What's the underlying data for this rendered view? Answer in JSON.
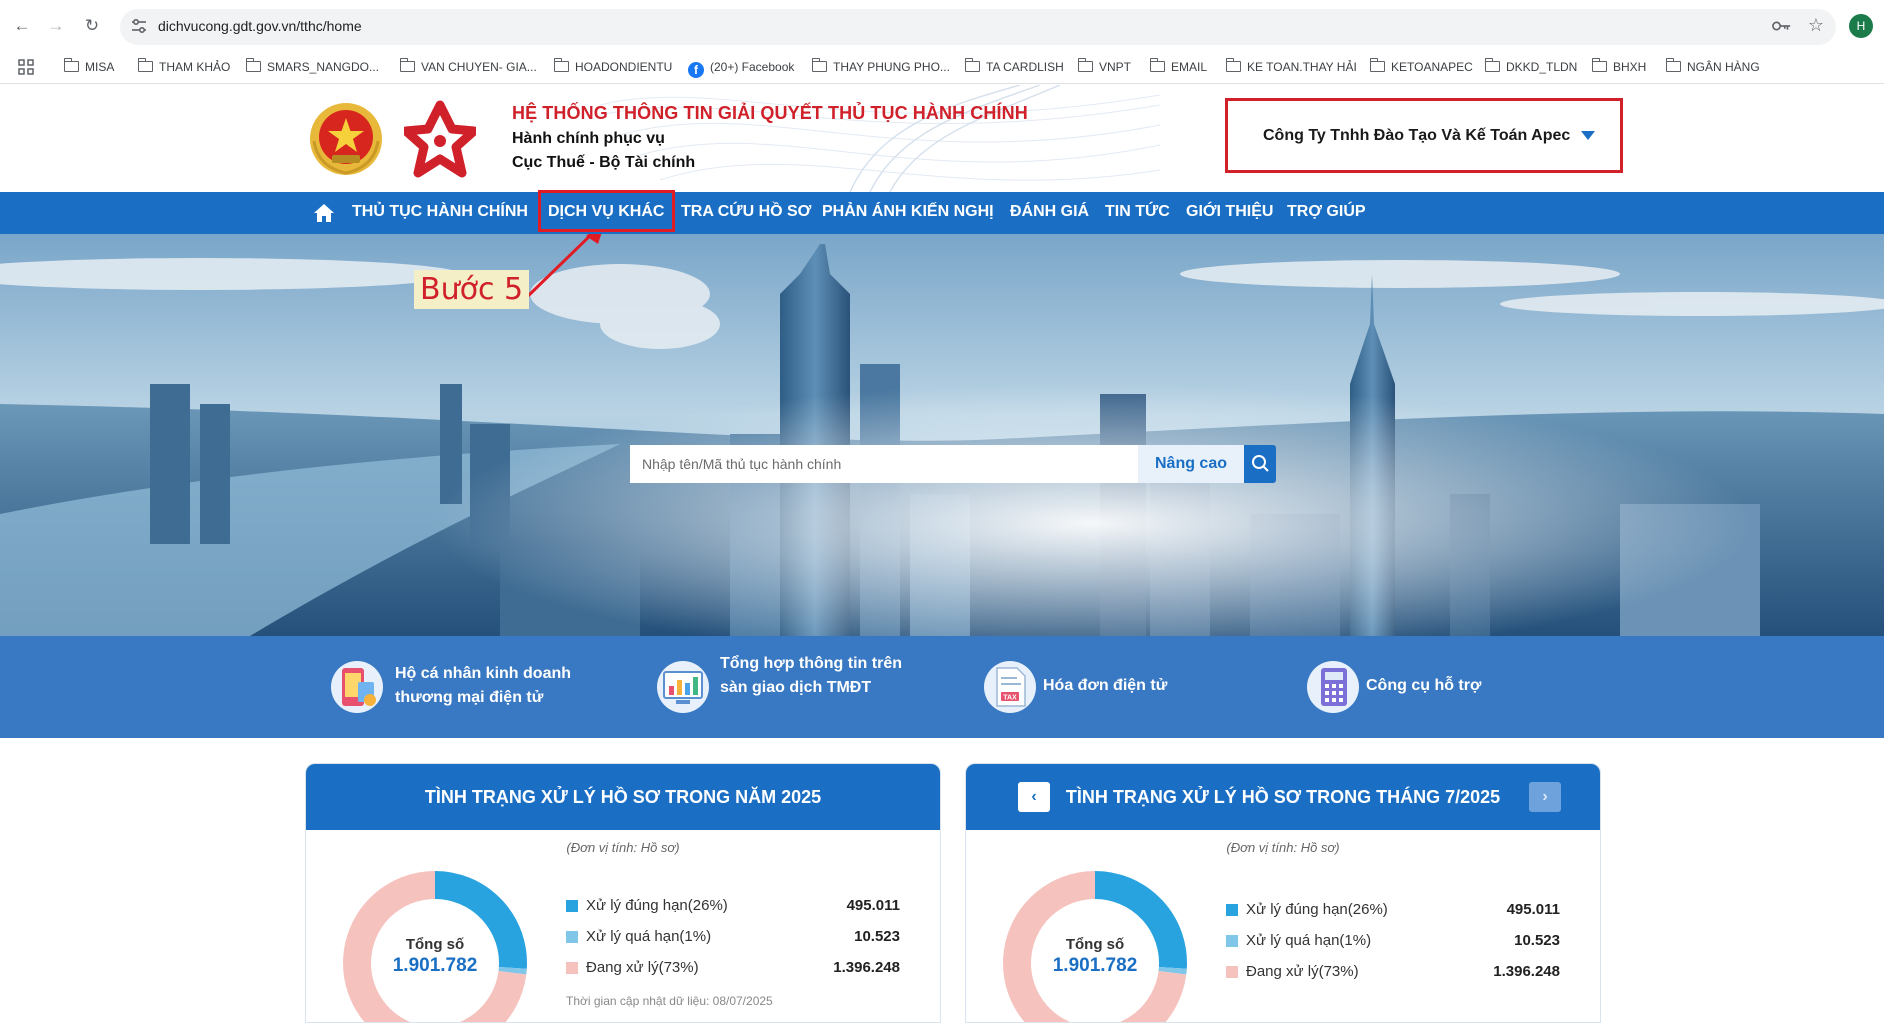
{
  "browser": {
    "url": "dichvucong.gdt.gov.vn/tthc/home",
    "profile_initial": "H",
    "bookmarks": [
      {
        "label": "MISA",
        "type": "folder"
      },
      {
        "label": "THAM KHẢO",
        "type": "folder"
      },
      {
        "label": "SMARS_NANGDO...",
        "type": "folder"
      },
      {
        "label": "VAN CHUYEN- GIA...",
        "type": "folder"
      },
      {
        "label": "HOADONDIENTU",
        "type": "folder"
      },
      {
        "label": "(20+) Facebook",
        "type": "facebook"
      },
      {
        "label": "THAY PHUNG PHO...",
        "type": "folder"
      },
      {
        "label": "TA CARDLISH",
        "type": "folder"
      },
      {
        "label": "VNPT",
        "type": "folder"
      },
      {
        "label": "EMAIL",
        "type": "folder"
      },
      {
        "label": "KE TOAN.THAY HẢI",
        "type": "folder"
      },
      {
        "label": "KETOANAPEC",
        "type": "folder"
      },
      {
        "label": "DKKD_TLDN",
        "type": "folder"
      },
      {
        "label": "BHXH",
        "type": "folder"
      },
      {
        "label": "NGÂN HÀNG",
        "type": "folder"
      }
    ]
  },
  "header": {
    "title": "HỆ THỐNG THÔNG TIN GIẢI QUYẾT THỦ TỤC HÀNH CHÍNH",
    "subtitle1": "Hành chính phục vụ",
    "subtitle2": "Cục Thuế - Bộ Tài chính",
    "company": "Công Ty Tnhh Đào Tạo Và Kế Toán Apec"
  },
  "nav": {
    "items": [
      "THỦ TỤC HÀNH CHÍNH",
      "DỊCH VỤ KHÁC",
      "TRA CỨU HỒ SƠ",
      "PHẢN ÁNH KIẾN NGHỊ",
      "ĐÁNH GIÁ",
      "TIN TỨC",
      "GIỚI THIỆU",
      "TRỢ GIÚP"
    ],
    "highlighted": "DỊCH VỤ KHÁC"
  },
  "annotation": {
    "step_label": "Bước 5",
    "color": "#e01b24"
  },
  "search": {
    "placeholder": "Nhập tên/Mã thủ tục hành chính",
    "advanced_label": "Nâng cao"
  },
  "services": {
    "items": [
      {
        "line1": "Hộ cá nhân kinh doanh",
        "line2": "thương mại điện tử",
        "icon": "shop-phone-icon"
      },
      {
        "line1": "Tổng hợp thông tin trên",
        "line2": "sàn giao dịch TMĐT",
        "icon": "report-chart-icon"
      },
      {
        "line1": "Hóa đơn điện tử",
        "line2": "",
        "icon": "tax-invoice-icon"
      },
      {
        "line1": "Công cụ hỗ trợ",
        "line2": "",
        "icon": "calculator-icon"
      }
    ]
  },
  "stats": {
    "year_card": {
      "title": "TÌNH TRẠNG XỬ LÝ HỒ SƠ TRONG NĂM 2025",
      "unit": "(Đơn vị tính: Hồ sơ)",
      "total_label": "Tổng số",
      "total_value": "1.901.782",
      "legend": [
        {
          "label": "Xử lý đúng hạn(26%)",
          "value": "495.011",
          "percent": 26,
          "color": "#29a3e0"
        },
        {
          "label": "Xử lý quá hạn(1%)",
          "value": "10.523",
          "percent": 1,
          "color": "#7fc6e8"
        },
        {
          "label": "Đang xử lý(73%)",
          "value": "1.396.248",
          "percent": 73,
          "color": "#f6c2bd"
        }
      ],
      "note": "Thời gian cập nhật dữ liệu: 08/07/2025"
    },
    "month_card": {
      "title": "TÌNH TRẠNG XỬ LÝ HỒ SƠ TRONG THÁNG 7/2025",
      "unit": "(Đơn vị tính: Hồ sơ)",
      "total_label": "Tổng số",
      "total_value": "1.901.782",
      "prev_label": "‹",
      "next_label": "›",
      "legend": [
        {
          "label": "Xử lý đúng hạn(26%)",
          "value": "495.011",
          "percent": 26,
          "color": "#29a3e0"
        },
        {
          "label": "Xử lý quá hạn(1%)",
          "value": "10.523",
          "percent": 1,
          "color": "#7fc6e8"
        },
        {
          "label": "Đang xử lý(73%)",
          "value": "1.396.248",
          "percent": 73,
          "color": "#f6c2bd"
        }
      ]
    }
  }
}
